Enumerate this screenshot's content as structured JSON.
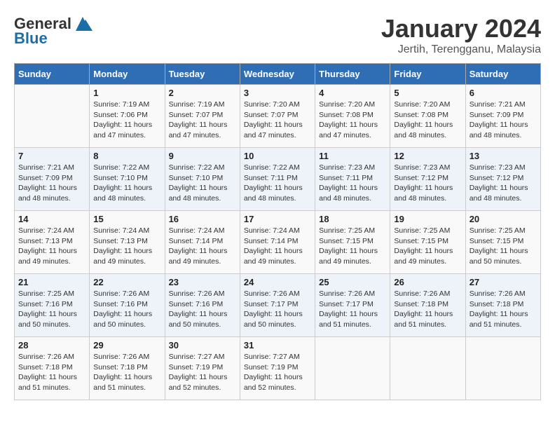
{
  "header": {
    "logo_general": "General",
    "logo_blue": "Blue",
    "month_title": "January 2024",
    "subtitle": "Jertih, Terengganu, Malaysia"
  },
  "days_of_week": [
    "Sunday",
    "Monday",
    "Tuesday",
    "Wednesday",
    "Thursday",
    "Friday",
    "Saturday"
  ],
  "weeks": [
    [
      {
        "day": "",
        "sunrise": "",
        "sunset": "",
        "daylight": ""
      },
      {
        "day": "1",
        "sunrise": "Sunrise: 7:19 AM",
        "sunset": "Sunset: 7:06 PM",
        "daylight": "Daylight: 11 hours and 47 minutes."
      },
      {
        "day": "2",
        "sunrise": "Sunrise: 7:19 AM",
        "sunset": "Sunset: 7:07 PM",
        "daylight": "Daylight: 11 hours and 47 minutes."
      },
      {
        "day": "3",
        "sunrise": "Sunrise: 7:20 AM",
        "sunset": "Sunset: 7:07 PM",
        "daylight": "Daylight: 11 hours and 47 minutes."
      },
      {
        "day": "4",
        "sunrise": "Sunrise: 7:20 AM",
        "sunset": "Sunset: 7:08 PM",
        "daylight": "Daylight: 11 hours and 47 minutes."
      },
      {
        "day": "5",
        "sunrise": "Sunrise: 7:20 AM",
        "sunset": "Sunset: 7:08 PM",
        "daylight": "Daylight: 11 hours and 48 minutes."
      },
      {
        "day": "6",
        "sunrise": "Sunrise: 7:21 AM",
        "sunset": "Sunset: 7:09 PM",
        "daylight": "Daylight: 11 hours and 48 minutes."
      }
    ],
    [
      {
        "day": "7",
        "sunrise": "Sunrise: 7:21 AM",
        "sunset": "Sunset: 7:09 PM",
        "daylight": "Daylight: 11 hours and 48 minutes."
      },
      {
        "day": "8",
        "sunrise": "Sunrise: 7:22 AM",
        "sunset": "Sunset: 7:10 PM",
        "daylight": "Daylight: 11 hours and 48 minutes."
      },
      {
        "day": "9",
        "sunrise": "Sunrise: 7:22 AM",
        "sunset": "Sunset: 7:10 PM",
        "daylight": "Daylight: 11 hours and 48 minutes."
      },
      {
        "day": "10",
        "sunrise": "Sunrise: 7:22 AM",
        "sunset": "Sunset: 7:11 PM",
        "daylight": "Daylight: 11 hours and 48 minutes."
      },
      {
        "day": "11",
        "sunrise": "Sunrise: 7:23 AM",
        "sunset": "Sunset: 7:11 PM",
        "daylight": "Daylight: 11 hours and 48 minutes."
      },
      {
        "day": "12",
        "sunrise": "Sunrise: 7:23 AM",
        "sunset": "Sunset: 7:12 PM",
        "daylight": "Daylight: 11 hours and 48 minutes."
      },
      {
        "day": "13",
        "sunrise": "Sunrise: 7:23 AM",
        "sunset": "Sunset: 7:12 PM",
        "daylight": "Daylight: 11 hours and 48 minutes."
      }
    ],
    [
      {
        "day": "14",
        "sunrise": "Sunrise: 7:24 AM",
        "sunset": "Sunset: 7:13 PM",
        "daylight": "Daylight: 11 hours and 49 minutes."
      },
      {
        "day": "15",
        "sunrise": "Sunrise: 7:24 AM",
        "sunset": "Sunset: 7:13 PM",
        "daylight": "Daylight: 11 hours and 49 minutes."
      },
      {
        "day": "16",
        "sunrise": "Sunrise: 7:24 AM",
        "sunset": "Sunset: 7:14 PM",
        "daylight": "Daylight: 11 hours and 49 minutes."
      },
      {
        "day": "17",
        "sunrise": "Sunrise: 7:24 AM",
        "sunset": "Sunset: 7:14 PM",
        "daylight": "Daylight: 11 hours and 49 minutes."
      },
      {
        "day": "18",
        "sunrise": "Sunrise: 7:25 AM",
        "sunset": "Sunset: 7:15 PM",
        "daylight": "Daylight: 11 hours and 49 minutes."
      },
      {
        "day": "19",
        "sunrise": "Sunrise: 7:25 AM",
        "sunset": "Sunset: 7:15 PM",
        "daylight": "Daylight: 11 hours and 49 minutes."
      },
      {
        "day": "20",
        "sunrise": "Sunrise: 7:25 AM",
        "sunset": "Sunset: 7:15 PM",
        "daylight": "Daylight: 11 hours and 50 minutes."
      }
    ],
    [
      {
        "day": "21",
        "sunrise": "Sunrise: 7:25 AM",
        "sunset": "Sunset: 7:16 PM",
        "daylight": "Daylight: 11 hours and 50 minutes."
      },
      {
        "day": "22",
        "sunrise": "Sunrise: 7:26 AM",
        "sunset": "Sunset: 7:16 PM",
        "daylight": "Daylight: 11 hours and 50 minutes."
      },
      {
        "day": "23",
        "sunrise": "Sunrise: 7:26 AM",
        "sunset": "Sunset: 7:16 PM",
        "daylight": "Daylight: 11 hours and 50 minutes."
      },
      {
        "day": "24",
        "sunrise": "Sunrise: 7:26 AM",
        "sunset": "Sunset: 7:17 PM",
        "daylight": "Daylight: 11 hours and 50 minutes."
      },
      {
        "day": "25",
        "sunrise": "Sunrise: 7:26 AM",
        "sunset": "Sunset: 7:17 PM",
        "daylight": "Daylight: 11 hours and 51 minutes."
      },
      {
        "day": "26",
        "sunrise": "Sunrise: 7:26 AM",
        "sunset": "Sunset: 7:18 PM",
        "daylight": "Daylight: 11 hours and 51 minutes."
      },
      {
        "day": "27",
        "sunrise": "Sunrise: 7:26 AM",
        "sunset": "Sunset: 7:18 PM",
        "daylight": "Daylight: 11 hours and 51 minutes."
      }
    ],
    [
      {
        "day": "28",
        "sunrise": "Sunrise: 7:26 AM",
        "sunset": "Sunset: 7:18 PM",
        "daylight": "Daylight: 11 hours and 51 minutes."
      },
      {
        "day": "29",
        "sunrise": "Sunrise: 7:26 AM",
        "sunset": "Sunset: 7:18 PM",
        "daylight": "Daylight: 11 hours and 51 minutes."
      },
      {
        "day": "30",
        "sunrise": "Sunrise: 7:27 AM",
        "sunset": "Sunset: 7:19 PM",
        "daylight": "Daylight: 11 hours and 52 minutes."
      },
      {
        "day": "31",
        "sunrise": "Sunrise: 7:27 AM",
        "sunset": "Sunset: 7:19 PM",
        "daylight": "Daylight: 11 hours and 52 minutes."
      },
      {
        "day": "",
        "sunrise": "",
        "sunset": "",
        "daylight": ""
      },
      {
        "day": "",
        "sunrise": "",
        "sunset": "",
        "daylight": ""
      },
      {
        "day": "",
        "sunrise": "",
        "sunset": "",
        "daylight": ""
      }
    ]
  ]
}
